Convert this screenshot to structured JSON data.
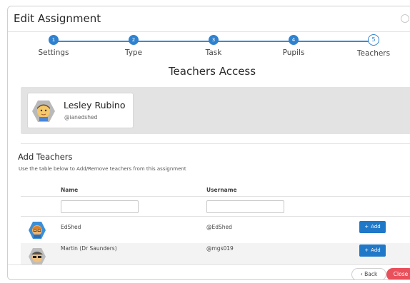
{
  "modal": {
    "title": "Edit Assignment"
  },
  "steps": [
    {
      "number": "1",
      "label": "Settings"
    },
    {
      "number": "2",
      "label": "Type"
    },
    {
      "number": "3",
      "label": "Task"
    },
    {
      "number": "4",
      "label": "Pupils"
    },
    {
      "number": "5",
      "label": "Teachers"
    }
  ],
  "section_title": "Teachers Access",
  "owner": {
    "name": "Lesley Rubino",
    "handle": "@ianedshed"
  },
  "add_teachers": {
    "title": "Add Teachers",
    "help": "Use the table below to Add/Remove teachers from this assignment"
  },
  "table": {
    "columns": {
      "name": "Name",
      "username": "Username"
    },
    "filters": {
      "name_value": "",
      "username_value": ""
    },
    "rows": [
      {
        "name": "EdShed",
        "username": "@EdShed",
        "action": "Add"
      },
      {
        "name": "Martin (Dr Saunders)",
        "username": "@mgs019",
        "action": "Add"
      }
    ],
    "add_prefix": "+"
  },
  "footer": {
    "back_arrow": "‹",
    "back_label": "Back",
    "close_label": "Close"
  },
  "colors": {
    "accent": "#2e82d0",
    "add_button": "#1f78c8",
    "close_button": "#e8505b",
    "owner_panel": "#e3e3e3"
  }
}
